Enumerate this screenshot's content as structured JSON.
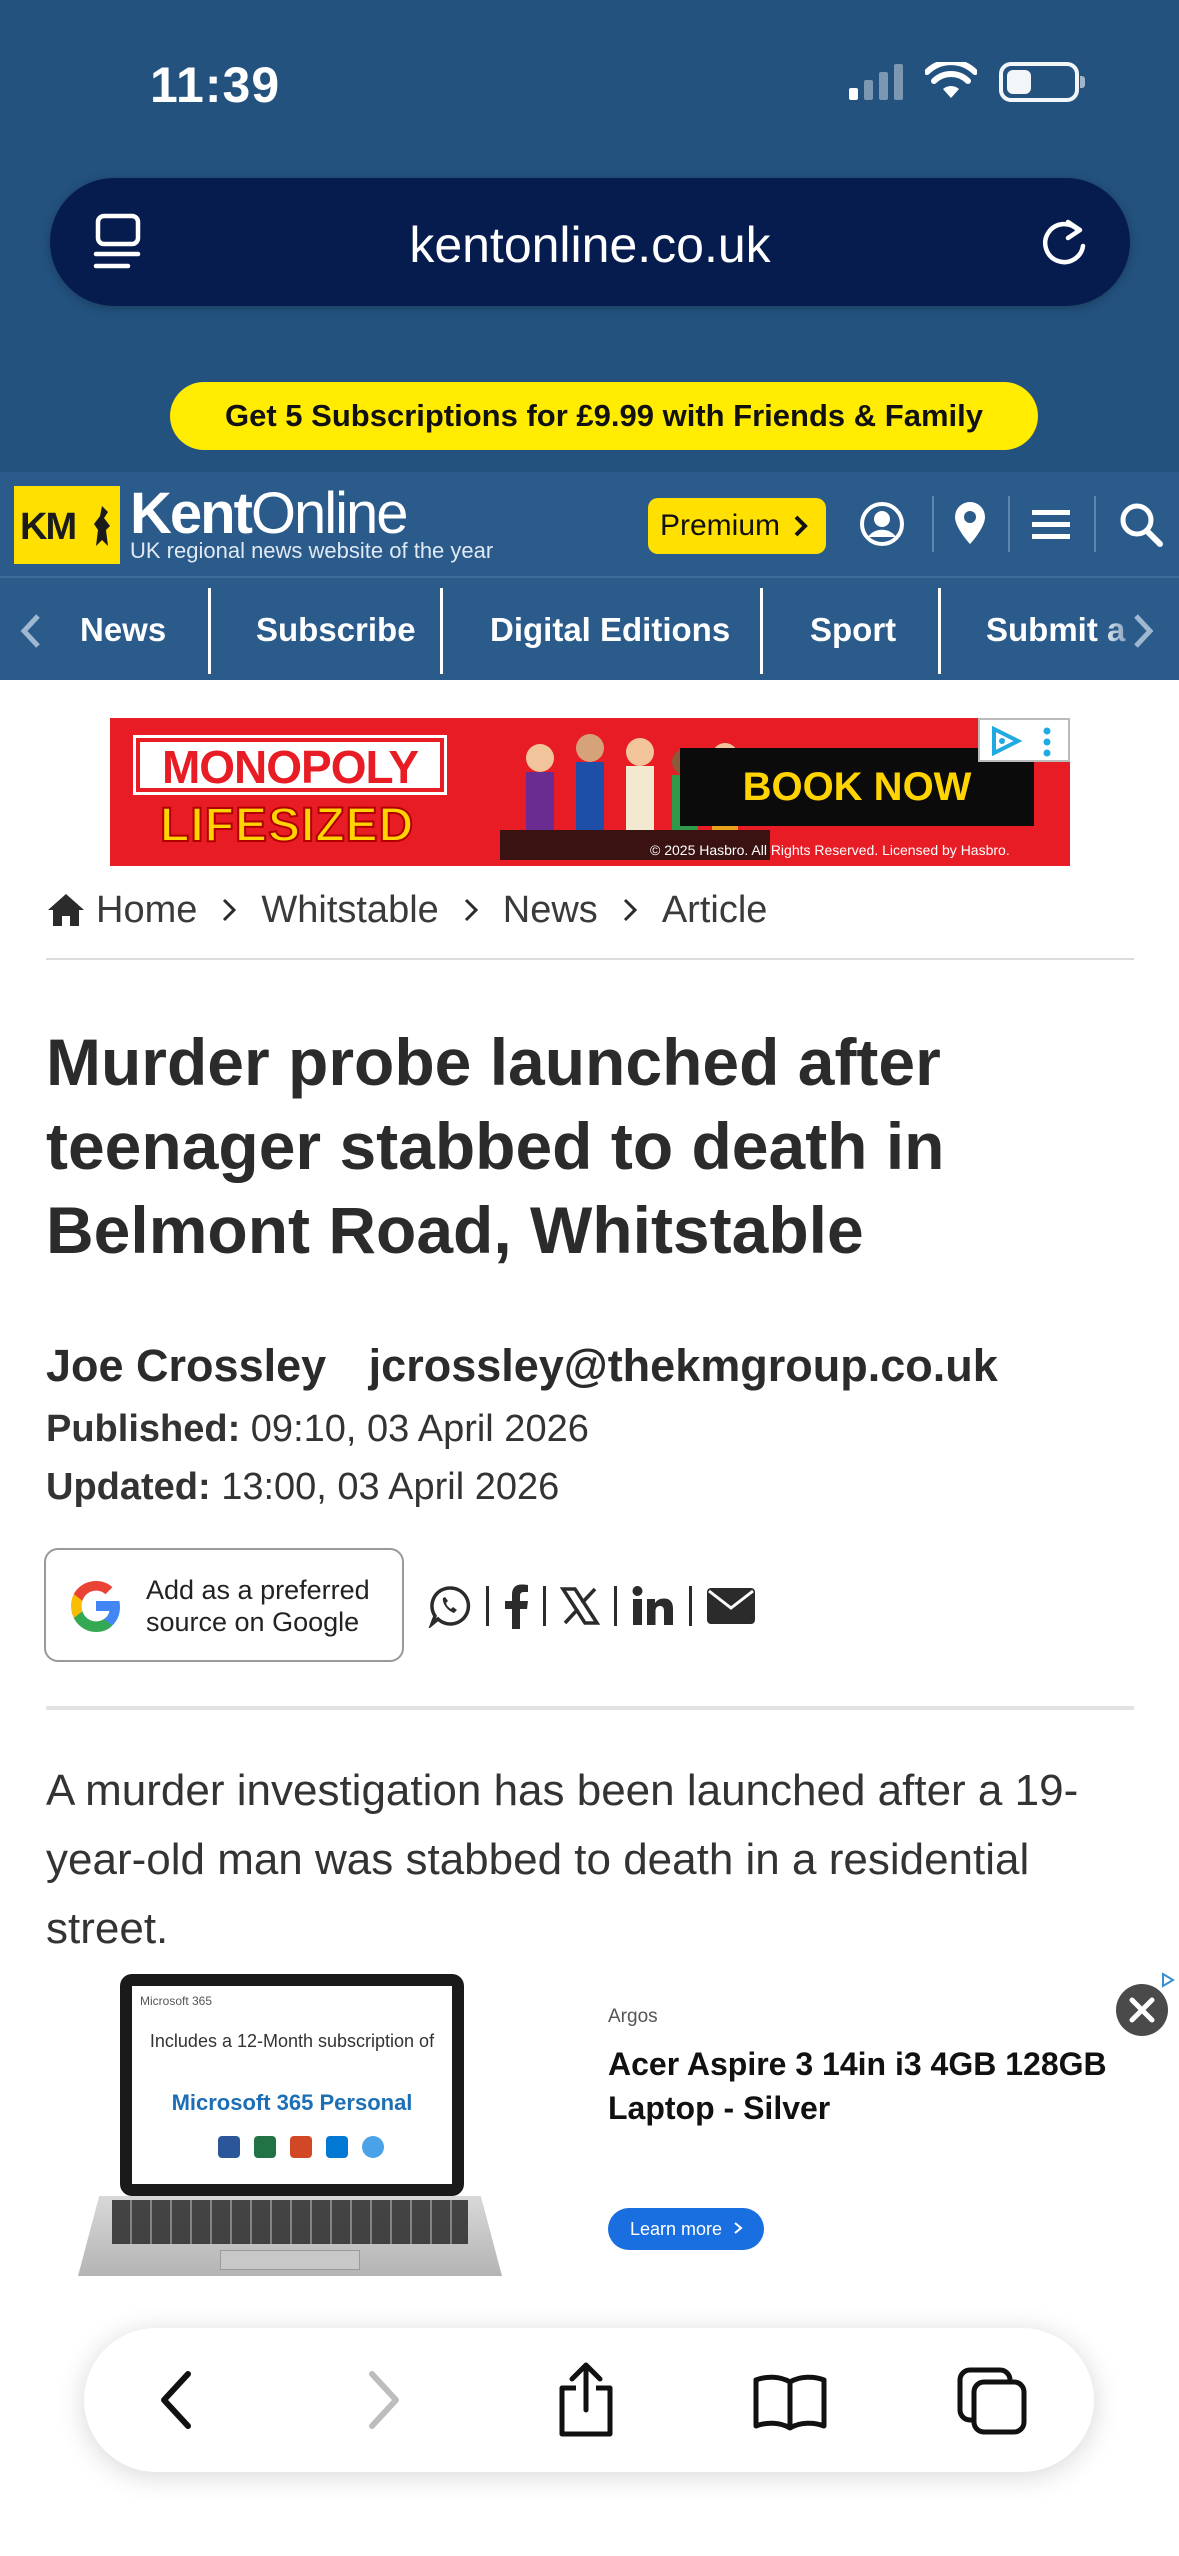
{
  "status_bar": {
    "time": "11:39"
  },
  "browser": {
    "url": "kentonline.co.uk",
    "promo": "Get 5 Subscriptions for £9.99 with Friends & Family",
    "toolbar": {
      "back_icon": "chevron-left-icon",
      "forward_icon": "chevron-right-icon",
      "share_icon": "share-icon",
      "bookmarks_icon": "book-icon",
      "tabs_icon": "tabs-icon"
    }
  },
  "site_header": {
    "logo_text": "KM",
    "brand_name_bold": "Kent",
    "brand_name_light": "Online",
    "tagline": "UK regional news website of the year",
    "premium_label": "Premium",
    "icons": [
      "user-icon",
      "location-pin-icon",
      "menu-icon",
      "search-icon"
    ]
  },
  "nav": {
    "items": [
      "News",
      "Subscribe",
      "Digital Editions",
      "Sport",
      "Submit a"
    ]
  },
  "top_ad": {
    "title": "MONOPOLY",
    "subtitle": "LIFESIZED",
    "cta": "BOOK NOW",
    "copyright": "© 2025 Hasbro. All Rights Reserved. Licensed by Hasbro."
  },
  "breadcrumb": [
    "Home",
    "Whitstable",
    "News",
    "Article"
  ],
  "article": {
    "headline": "Murder probe launched after teenager stabbed to death in Belmont Road, Whitstable",
    "author": "Joe Crossley",
    "author_email": "jcrossley@thekmgroup.co.uk",
    "published_label": "Published:",
    "published_value": "09:10, 03 April 2026",
    "updated_label": "Updated:",
    "updated_value": "13:00, 03 April 2026",
    "google_btn_line1": "Add as a preferred",
    "google_btn_line2": "source on Google",
    "share_icons": [
      "whatsapp-icon",
      "facebook-icon",
      "x-icon",
      "linkedin-icon",
      "email-icon"
    ],
    "lede": "A murder investigation has been launched after a 19-year-old man was stabbed to death in a residential street."
  },
  "bottom_ad": {
    "screen_brand": "Microsoft 365",
    "screen_line1": "Includes a 12-Month subscription of",
    "screen_line2": "Microsoft 365 Personal",
    "advertiser": "Argos",
    "title": "Acer Aspire 3 14in i3 4GB 128GB Laptop - Silver",
    "cta": "Learn more"
  },
  "colors": {
    "browser_bg": "#23527f",
    "url_bar": "#061c4e",
    "site_header": "#2a5b8b",
    "accent_yellow": "#ffe000",
    "text": "#2b2b2b"
  }
}
